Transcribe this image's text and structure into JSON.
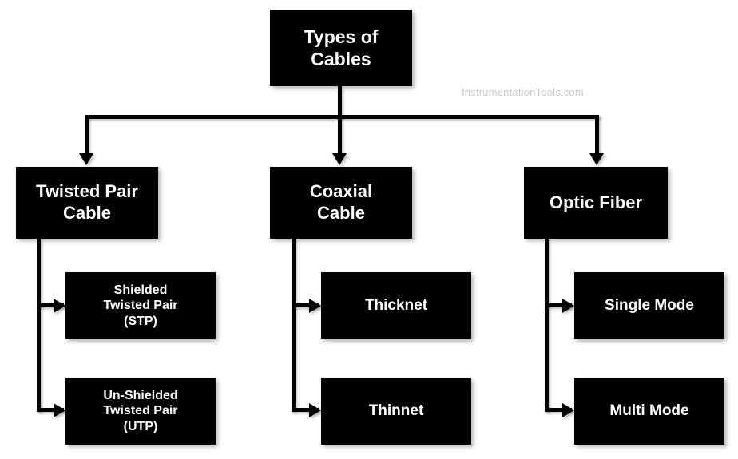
{
  "diagram": {
    "title": "Types of Cables",
    "watermark": "InstrumentationTools.com",
    "colors": {
      "node_background": "#000000",
      "node_text": "#ffffff",
      "connector": "#000000",
      "canvas_background": "#ffffff",
      "watermark_text": "#c9c9d2"
    },
    "root": {
      "label": "Types of Cables",
      "line1": "Types of",
      "line2": "Cables"
    },
    "branches": [
      {
        "id": "twisted-pair",
        "label": "Twisted Pair Cable",
        "line1": "Twisted Pair",
        "line2": "Cable",
        "children": [
          {
            "id": "stp",
            "label": "Shielded Twisted Pair (STP)",
            "line1": "Shielded",
            "line2": "Twisted Pair",
            "line3": "(STP)"
          },
          {
            "id": "utp",
            "label": "Un-Shielded Twisted Pair (UTP)",
            "line1": "Un-Shielded",
            "line2": "Twisted Pair",
            "line3": "(UTP)"
          }
        ]
      },
      {
        "id": "coaxial",
        "label": "Coaxial Cable",
        "line1": "Coaxial",
        "line2": "Cable",
        "children": [
          {
            "id": "thicknet",
            "label": "Thicknet"
          },
          {
            "id": "thinnet",
            "label": "Thinnet"
          }
        ]
      },
      {
        "id": "optic-fiber",
        "label": "Optic Fiber",
        "line1": "Optic Fiber",
        "children": [
          {
            "id": "single-mode",
            "label": "Single  Mode"
          },
          {
            "id": "multi-mode",
            "label": "Multi Mode"
          }
        ]
      }
    ]
  }
}
